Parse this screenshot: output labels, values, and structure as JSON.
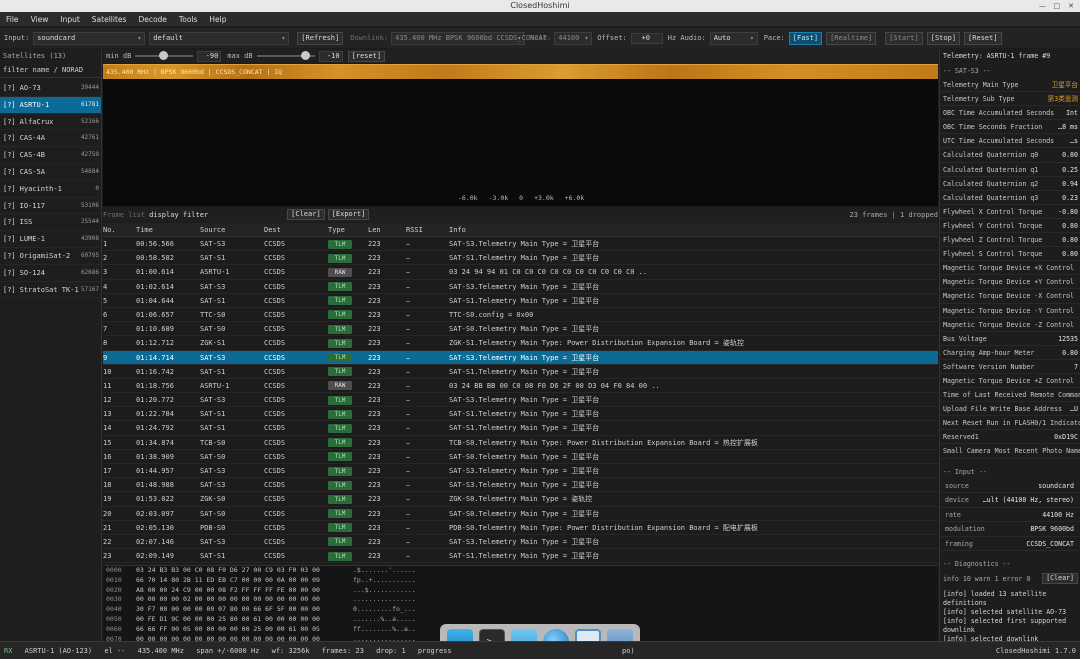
{
  "window": {
    "title": "ClosedHoshimi"
  },
  "menu": [
    "File",
    "View",
    "Input",
    "Satellites",
    "Decode",
    "Tools",
    "Help"
  ],
  "toolbar": {
    "input_label": "Input:",
    "input_value": "soundcard",
    "device_value": "default",
    "refresh": "[Refresh]",
    "downlink_label": "Downlink:",
    "downlink_value": "435.400 MHz BPSK 9600bd CCSDS_CONCAT",
    "rate_label": "Rate:",
    "rate_value": "44100",
    "offset_label": "Offset:",
    "offset_value": "+0",
    "hz_audio_label": "Hz Audio:",
    "audio_value": "Auto",
    "pace_label": "Pace:",
    "pace_fast": "[Fast]",
    "pace_realtime": "[Realtime]",
    "start": "[Start]",
    "stop": "[Stop]",
    "reset": "[Reset]"
  },
  "satellites": {
    "header": "Satellites (13)",
    "filter_placeholder": "filter name / NORAD",
    "items": [
      {
        "flag": "[?]",
        "name": "AO-73",
        "norad": "39444"
      },
      {
        "flag": "[?]",
        "name": "ASRTU-1",
        "norad": "61781",
        "selected": true
      },
      {
        "flag": "[?]",
        "name": "AlfaCrux",
        "norad": "52166"
      },
      {
        "flag": "[?]",
        "name": "CAS-4A",
        "norad": "42761"
      },
      {
        "flag": "[?]",
        "name": "CAS-4B",
        "norad": "42759"
      },
      {
        "flag": "[?]",
        "name": "CAS-5A",
        "norad": "54684"
      },
      {
        "flag": "[?]",
        "name": "Hyacinth-1",
        "norad": "0"
      },
      {
        "flag": "[?]",
        "name": "IO-117",
        "norad": "53106"
      },
      {
        "flag": "[?]",
        "name": "ISS",
        "norad": "25544"
      },
      {
        "flag": "[?]",
        "name": "LUME-1",
        "norad": "43908"
      },
      {
        "flag": "[?]",
        "name": "OrigamiSat-2",
        "norad": "60795"
      },
      {
        "flag": "[?]",
        "name": "SO-124",
        "norad": "62686"
      },
      {
        "flag": "[?]",
        "name": "StratoSat TK-1",
        "norad": "57167"
      }
    ]
  },
  "waterfall": {
    "min_db_label": "min dB",
    "min_db": "-90",
    "max_db_label": "max dB",
    "max_db": "-10",
    "reset": "[reset]",
    "overlay": "435.400 MHz | BPSK 9600bd | CCSDS_CONCAT | IQ",
    "ticks": [
      "-6.0k",
      "-3.0k",
      "0",
      "+3.0k",
      "+6.0k"
    ]
  },
  "frame_list": {
    "title": "Frame list",
    "filter_placeholder": "display filter",
    "clear": "[Clear]",
    "export": "[Export]",
    "summary": "23 frames | 1 dropped",
    "columns": [
      "No.",
      "Time",
      "Source",
      "Dest",
      "Type",
      "Len",
      "RSSI",
      "Info"
    ],
    "rows": [
      {
        "no": "1",
        "time": "00:56.566",
        "src": "SAT-S3",
        "dst": "CCSDS",
        "type": "TLM",
        "len": "223",
        "rssi": "–",
        "info": "SAT-S3.Telemetry Main Type = 卫星平台"
      },
      {
        "no": "2",
        "time": "00:58.582",
        "src": "SAT-S1",
        "dst": "CCSDS",
        "type": "TLM",
        "len": "223",
        "rssi": "–",
        "info": "SAT-S1.Telemetry Main Type = 卫星平台"
      },
      {
        "no": "3",
        "time": "01:00.614",
        "src": "ASRTU-1",
        "dst": "CCSDS",
        "type": "RAW",
        "len": "223",
        "rssi": "–",
        "info": "03 24 94 94 01 C0 C0 C0 C0 C0 C0 C0 C0 C0 C0 .."
      },
      {
        "no": "4",
        "time": "01:02.614",
        "src": "SAT-S3",
        "dst": "CCSDS",
        "type": "TLM",
        "len": "223",
        "rssi": "–",
        "info": "SAT-S3.Telemetry Main Type = 卫星平台"
      },
      {
        "no": "5",
        "time": "01:04.644",
        "src": "SAT-S1",
        "dst": "CCSDS",
        "type": "TLM",
        "len": "223",
        "rssi": "–",
        "info": "SAT-S1.Telemetry Main Type = 卫星平台"
      },
      {
        "no": "6",
        "time": "01:06.657",
        "src": "TTC-S0",
        "dst": "CCSDS",
        "type": "TLM",
        "len": "223",
        "rssi": "–",
        "info": "TTC-S0.config = 0x00"
      },
      {
        "no": "7",
        "time": "01:10.689",
        "src": "SAT-S0",
        "dst": "CCSDS",
        "type": "TLM",
        "len": "223",
        "rssi": "–",
        "info": "SAT-S0.Telemetry Main Type = 卫星平台"
      },
      {
        "no": "8",
        "time": "01:12.712",
        "src": "ZGK-S1",
        "dst": "CCSDS",
        "type": "TLM",
        "len": "223",
        "rssi": "–",
        "info": "ZGK-S1.Telemetry Main Type: Power Distribution Expansion Board = 姿轨控"
      },
      {
        "no": "9",
        "time": "01:14.714",
        "src": "SAT-S3",
        "dst": "CCSDS",
        "type": "TLM",
        "len": "223",
        "rssi": "–",
        "info": "SAT-S3.Telemetry Main Type = 卫星平台",
        "selected": true
      },
      {
        "no": "10",
        "time": "01:16.742",
        "src": "SAT-S1",
        "dst": "CCSDS",
        "type": "TLM",
        "len": "223",
        "rssi": "–",
        "info": "SAT-S1.Telemetry Main Type = 卫星平台"
      },
      {
        "no": "11",
        "time": "01:18.756",
        "src": "ASRTU-1",
        "dst": "CCSDS",
        "type": "RAW",
        "len": "223",
        "rssi": "–",
        "info": "03 24 BB BB 00 C0 08 F0 D6 2F 00 D3 04 F0 84 00 .."
      },
      {
        "no": "12",
        "time": "01:20.772",
        "src": "SAT-S3",
        "dst": "CCSDS",
        "type": "TLM",
        "len": "223",
        "rssi": "–",
        "info": "SAT-S3.Telemetry Main Type = 卫星平台"
      },
      {
        "no": "13",
        "time": "01:22.784",
        "src": "SAT-S1",
        "dst": "CCSDS",
        "type": "TLM",
        "len": "223",
        "rssi": "–",
        "info": "SAT-S1.Telemetry Main Type = 卫星平台"
      },
      {
        "no": "14",
        "time": "01:24.792",
        "src": "SAT-S1",
        "dst": "CCSDS",
        "type": "TLM",
        "len": "223",
        "rssi": "–",
        "info": "SAT-S1.Telemetry Main Type = 卫星平台"
      },
      {
        "no": "15",
        "time": "01:34.874",
        "src": "TCB-S0",
        "dst": "CCSDS",
        "type": "TLM",
        "len": "223",
        "rssi": "–",
        "info": "TCB-S0.Telemetry Main Type: Power Distribution Expansion Board = 热控扩展板"
      },
      {
        "no": "16",
        "time": "01:38.909",
        "src": "SAT-S0",
        "dst": "CCSDS",
        "type": "TLM",
        "len": "223",
        "rssi": "–",
        "info": "SAT-S0.Telemetry Main Type = 卫星平台"
      },
      {
        "no": "17",
        "time": "01:44.957",
        "src": "SAT-S3",
        "dst": "CCSDS",
        "type": "TLM",
        "len": "223",
        "rssi": "–",
        "info": "SAT-S3.Telemetry Main Type = 卫星平台"
      },
      {
        "no": "18",
        "time": "01:48.988",
        "src": "SAT-S3",
        "dst": "CCSDS",
        "type": "TLM",
        "len": "223",
        "rssi": "–",
        "info": "SAT-S3.Telemetry Main Type = 卫星平台"
      },
      {
        "no": "19",
        "time": "01:53.022",
        "src": "ZGK-S0",
        "dst": "CCSDS",
        "type": "TLM",
        "len": "223",
        "rssi": "–",
        "info": "ZGK-S0.Telemetry Main Type = 姿轨控"
      },
      {
        "no": "20",
        "time": "02:03.097",
        "src": "SAT-S0",
        "dst": "CCSDS",
        "type": "TLM",
        "len": "223",
        "rssi": "–",
        "info": "SAT-S0.Telemetry Main Type = 卫星平台"
      },
      {
        "no": "21",
        "time": "02:05.130",
        "src": "PDB-S0",
        "dst": "CCSDS",
        "type": "TLM",
        "len": "223",
        "rssi": "–",
        "info": "PDB-S0.Telemetry Main Type: Power Distribution Expansion Board = 配电扩展板"
      },
      {
        "no": "22",
        "time": "02:07.146",
        "src": "SAT-S3",
        "dst": "CCSDS",
        "type": "TLM",
        "len": "223",
        "rssi": "–",
        "info": "SAT-S3.Telemetry Main Type = 卫星平台"
      },
      {
        "no": "23",
        "time": "02:09.149",
        "src": "SAT-S1",
        "dst": "CCSDS",
        "type": "TLM",
        "len": "223",
        "rssi": "–",
        "info": "SAT-S1.Telemetry Main Type = 卫星平台"
      }
    ]
  },
  "hexdump": [
    {
      "off": "0000",
      "hex": "03 24 B3 B3 00 C0 08 F0 D6 27 00 C9 03 F0 03 00",
      "ascii": ".$.......'......"
    },
    {
      "off": "0010",
      "hex": "66 70 14 80 2B 11 ED EB C7 00 00 00 0A 00 00 09",
      "ascii": "fp..+..........."
    },
    {
      "off": "0020",
      "hex": "A8 00 00 24 C9 00 00 08 F2 FF FF FF FE 00 00 00",
      "ascii": "...$............"
    },
    {
      "off": "0030",
      "hex": "00 00 00 00 02 00 00 00 00 00 00 00 00 00 00 00",
      "ascii": "................"
    },
    {
      "off": "0040",
      "hex": "30 F7 00 00 00 00 00 07 80 00 66 6F 5F 00 00 00",
      "ascii": "0.........fo_..."
    },
    {
      "off": "0050",
      "hex": "00 FE D1 9C 00 00 00 25 80 00 61 00 00 00 00 00",
      "ascii": ".......%..a....."
    },
    {
      "off": "0060",
      "hex": "66 66 FF 00 05 00 00 00 00 00 25 00 00 61 00 05",
      "ascii": "ff........%..a.."
    },
    {
      "off": "0070",
      "hex": "00 00 00 00 00 00 00 00 00 00 00 00 00 00 00 00",
      "ascii": "................"
    }
  ],
  "telemetry": {
    "title": "Telemetry: ASRTU-1 frame #9",
    "section": "-- SAT-S3 --",
    "fields": [
      {
        "k": "Telemetry Main Type",
        "v": "卫星平台",
        "accent": true
      },
      {
        "k": "Telemetry Sub Type",
        "v": "第3类遥测",
        "accent": true
      },
      {
        "k": "OBC Time Accumulated Seconds",
        "v": "Int"
      },
      {
        "k": "OBC Time Seconds Fraction",
        "v": "…8 ms"
      },
      {
        "k": "UTC Time Accumulated Seconds",
        "v": "…s"
      },
      {
        "k": "Calculated Quaternion q0",
        "v": "0.80"
      },
      {
        "k": "Calculated Quaternion q1",
        "v": "0.25"
      },
      {
        "k": "Calculated Quaternion q2",
        "v": "0.94"
      },
      {
        "k": "Calculated Quaternion q3",
        "v": "0.23"
      },
      {
        "k": "Flywheel X Control Torque",
        "v": "-0.80"
      },
      {
        "k": "Flywheel Y Control Torque",
        "v": "0.80"
      },
      {
        "k": "Flywheel Z Control Torque",
        "v": "0.80"
      },
      {
        "k": "Flywheel S Control Torque",
        "v": "0.80"
      },
      {
        "k": "Magnetic Torque Device +X Control",
        "v": ""
      },
      {
        "k": "Magnetic Torque Device +Y Control",
        "v": ""
      },
      {
        "k": "Magnetic Torque Device -X Control",
        "v": ""
      },
      {
        "k": "Magnetic Torque Device -Y Control",
        "v": ""
      },
      {
        "k": "Magnetic Torque Device -Z Control",
        "v": ""
      },
      {
        "k": "Bus Voltage",
        "v": "12535"
      },
      {
        "k": "Charging Amp-hour Meter",
        "v": "0.80"
      },
      {
        "k": "Software Version Number",
        "v": "7"
      },
      {
        "k": "Magnetic Torque Device +Z Control",
        "v": ""
      },
      {
        "k": "Time of Last Received Remote Command",
        "v": ""
      },
      {
        "k": "Upload File Write Base Address",
        "v": "…U"
      },
      {
        "k": "Next Reset Run in FLASH0/1 Indicator",
        "v": ""
      },
      {
        "k": "Reserved1",
        "v": "0xD19C"
      },
      {
        "k": "Small Camera Most Recent Photo Name",
        "v": ""
      }
    ],
    "input_section": "-- Input --",
    "input_fields": [
      {
        "k": "source",
        "v": "soundcard"
      },
      {
        "k": "device",
        "v": "…ult (44100 Hz, stereo)"
      },
      {
        "k": "rate",
        "v": "44100 Hz"
      },
      {
        "k": "modulation",
        "v": "BPSK 9600bd"
      },
      {
        "k": "framing",
        "v": "CCSDS_CONCAT"
      }
    ],
    "diag_section": "-- Diagnostics --",
    "diag_summary": "info 10 warn 1 error 0",
    "diag_clear": "[Clear]",
    "log": [
      "[info] loaded 13 satellite definitions",
      "[info] selected satellite AO-73",
      "[info] selected first supported downlink",
      "[info] selected downlink"
    ]
  },
  "status": {
    "rx": "RX",
    "sat": "ASRTU-1 (AO-123)",
    "el": "el --",
    "freq": "435.400 MHz",
    "span": "span +/-6000 Hz",
    "wf": "wf: 3256k",
    "frames": "frames: 23",
    "drop": "drop: 1",
    "progress": "progress",
    "tail": "po)",
    "app": "ClosedHoshimi 1.7.0"
  },
  "colors": {
    "accent": "#0b6a96",
    "tlm_badge": "#2c6b3a",
    "waterfall": "#c47d16",
    "cn_value": "#e0a22a"
  }
}
